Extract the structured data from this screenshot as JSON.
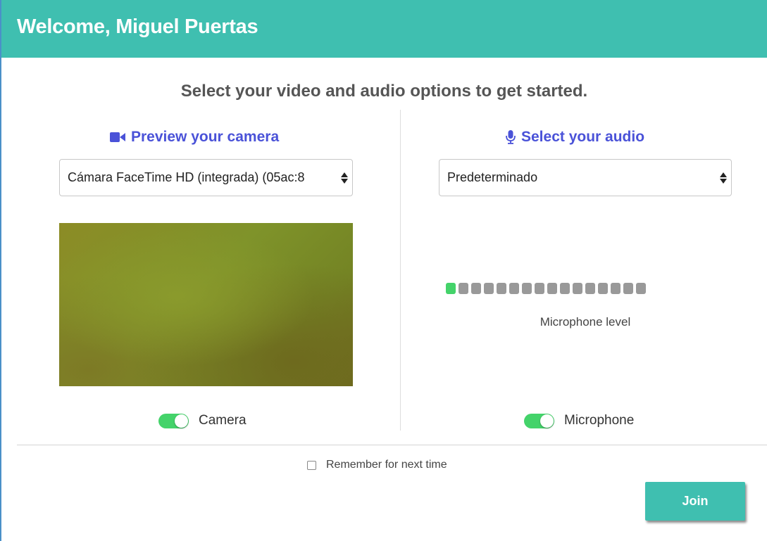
{
  "header": {
    "title": "Welcome, Miguel Puertas"
  },
  "subtitle": "Select your video and audio options to get started.",
  "camera": {
    "title": "Preview your camera",
    "icon": "video-camera-icon",
    "selected_device": "Cámara FaceTime HD (integrada) (05ac:8",
    "toggle_label": "Camera",
    "enabled": true
  },
  "audio": {
    "title": "Select your audio",
    "icon": "microphone-icon",
    "selected_device": "Predeterminado",
    "level_label": "Microphone level",
    "level_segments_total": 16,
    "level_segments_active": 1,
    "toggle_label": "Microphone",
    "enabled": true
  },
  "remember": {
    "label": "Remember for next time",
    "checked": false
  },
  "join": {
    "label": "Join"
  },
  "colors": {
    "header": "#3fbfb0",
    "accent_title": "#4a52d8",
    "toggle_on": "#44d36a",
    "meter_active": "#44d36a",
    "meter_inactive": "#999999"
  }
}
